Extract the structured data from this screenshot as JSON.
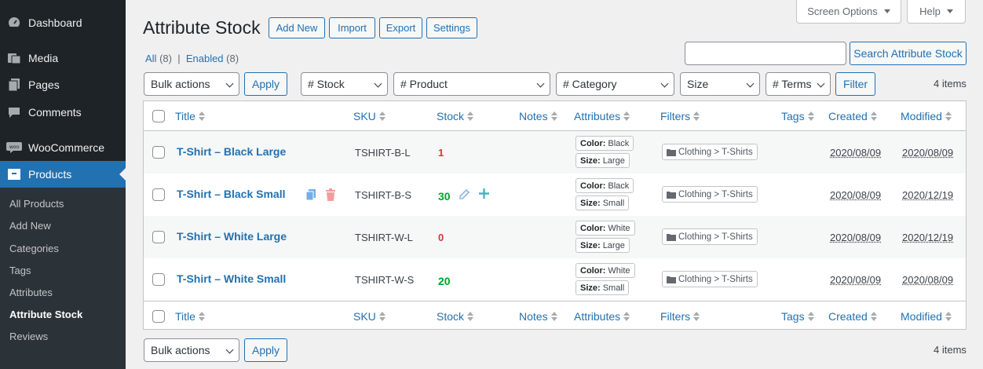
{
  "sidebar": {
    "menu": [
      {
        "label": "Dashboard",
        "icon": "dashboard-icon"
      },
      {
        "label": "Media",
        "icon": "media-icon"
      },
      {
        "label": "Pages",
        "icon": "pages-icon"
      },
      {
        "label": "Comments",
        "icon": "comments-icon"
      },
      {
        "label": "WooCommerce",
        "icon": "woocommerce-icon"
      },
      {
        "label": "Products",
        "icon": "products-icon"
      }
    ],
    "submenu": [
      "All Products",
      "Add New",
      "Categories",
      "Tags",
      "Attributes",
      "Attribute Stock",
      "Reviews"
    ]
  },
  "header": {
    "title": "Attribute Stock",
    "buttons": [
      "Add New",
      "Import",
      "Export",
      "Settings"
    ],
    "screen_options": "Screen Options",
    "help": "Help"
  },
  "views": {
    "all_label": "All",
    "all_count": "(8)",
    "separator": "|",
    "enabled_label": "Enabled",
    "enabled_count": "(8)"
  },
  "search": {
    "value": "",
    "button": "Search Attribute Stock"
  },
  "top_nav": {
    "bulk_actions": "Bulk actions",
    "apply": "Apply",
    "filters": [
      "# Stock",
      "# Product",
      "# Category",
      "Size",
      "# Terms"
    ],
    "filter_button": "Filter",
    "items_count": "4 items"
  },
  "table": {
    "columns": [
      "Title",
      "SKU",
      "Stock",
      "Notes",
      "Attributes",
      "Filters",
      "Tags",
      "Created",
      "Modified"
    ],
    "rows": [
      {
        "title": "T-Shirt – Black Large",
        "sku": "TSHIRT-B-L",
        "stock": "1",
        "stock_color": "#d63638",
        "attr1_key": "Color:",
        "attr1_val": "Black",
        "attr2_key": "Size:",
        "attr2_val": "Large",
        "filter": "Clothing > T-Shirts",
        "created": "2020/08/09",
        "modified": "2020/08/09"
      },
      {
        "title": "T-Shirt – Black Small",
        "sku": "TSHIRT-B-S",
        "stock": "30",
        "stock_color": "#00a32a",
        "attr1_key": "Color:",
        "attr1_val": "Black",
        "attr2_key": "Size:",
        "attr2_val": "Small",
        "filter": "Clothing > T-Shirts",
        "created": "2020/08/09",
        "modified": "2020/12/19"
      },
      {
        "title": "T-Shirt – White Large",
        "sku": "TSHIRT-W-L",
        "stock": "0",
        "stock_color": "#d63638",
        "attr1_key": "Color:",
        "attr1_val": "White",
        "attr2_key": "Size:",
        "attr2_val": "Large",
        "filter": "Clothing > T-Shirts",
        "created": "2020/08/09",
        "modified": "2020/12/19"
      },
      {
        "title": "T-Shirt – White Small",
        "sku": "TSHIRT-W-S",
        "stock": "20",
        "stock_color": "#00a32a",
        "attr1_key": "Color:",
        "attr1_val": "White",
        "attr2_key": "Size:",
        "attr2_val": "Small",
        "filter": "Clothing > T-Shirts",
        "created": "2020/08/09",
        "modified": "2020/08/09"
      }
    ]
  },
  "bottom_nav": {
    "bulk_actions": "Bulk actions",
    "apply": "Apply",
    "items_count": "4 items"
  },
  "colors": {
    "accent": "#2271b1",
    "sidebar_bg": "#1d2327",
    "stock_low": "#d63638",
    "stock_ok": "#00a32a"
  }
}
